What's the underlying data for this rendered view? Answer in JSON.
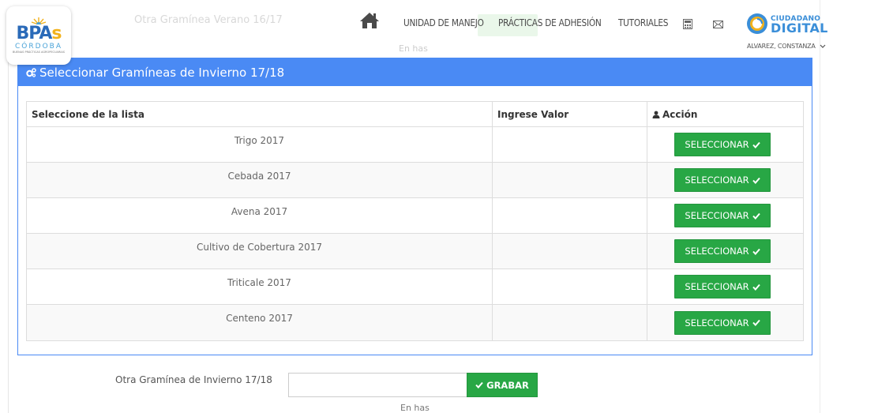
{
  "background": {
    "title": "Otra Gramínea Verano 16/17",
    "small_text": "En has"
  },
  "logo": {
    "main": "BPA",
    "main_s": "s",
    "sub": "CÓRDOBA",
    "tagline": "BUENAS PRÁCTICAS AGROPECUARIAS"
  },
  "nav": {
    "items": [
      {
        "label": "UNIDAD DE MANEJO"
      },
      {
        "label": "PRÁCTICAS DE ADHESIÓN"
      },
      {
        "label": "TUTORIALES"
      }
    ],
    "icons": [
      "home-icon",
      "calculator-icon",
      "envelope-icon"
    ]
  },
  "ciudadano": {
    "line1": "CIUDADANO",
    "line2": "DIGITAL",
    "user": "ALVAREZ, CONSTANZA"
  },
  "panel": {
    "title": "Seleccionar Gramíneas de Invierno 17/18",
    "columns": {
      "name": "Seleccione de la lista",
      "value": "Ingrese Valor",
      "action": "Acción"
    },
    "rows": [
      {
        "name": "Trigo 2017",
        "button": "SELECCIONAR"
      },
      {
        "name": "Cebada 2017",
        "button": "SELECCIONAR"
      },
      {
        "name": "Avena 2017",
        "button": "SELECCIONAR"
      },
      {
        "name": "Cultivo de Cobertura 2017",
        "button": "SELECCIONAR"
      },
      {
        "name": "Triticale 2017",
        "button": "SELECCIONAR"
      },
      {
        "name": "Centeno 2017",
        "button": "SELECCIONAR"
      }
    ]
  },
  "form": {
    "label": "Otra Gramínea de Invierno 17/18",
    "value": "",
    "save_label": "GRABAR",
    "hint": "En has"
  },
  "colors": {
    "header_blue": "#4a8af4",
    "button_green": "#28a745",
    "brand_blue": "#3a8ed8"
  }
}
